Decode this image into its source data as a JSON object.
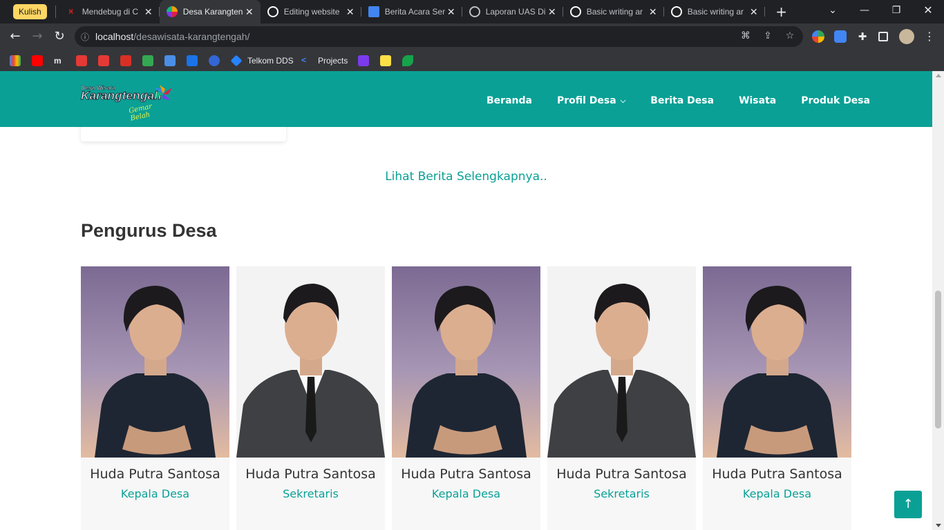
{
  "browser": {
    "tab_group": "Kulish",
    "tabs": [
      {
        "title": "Mendebug di C",
        "icon": "debug-icon",
        "color": "#c5221f"
      },
      {
        "title": "Desa Karangten",
        "icon": "site-favicon",
        "color": "#ffffff",
        "active": true
      },
      {
        "title": "Editing website",
        "icon": "github-icon",
        "color": "#ffffff"
      },
      {
        "title": "Berita Acara Ser",
        "icon": "docs-icon",
        "color": "#4285f4"
      },
      {
        "title": "Laporan UAS Di",
        "icon": "globe-icon",
        "color": "#bdc1c6"
      },
      {
        "title": "Basic writing ar",
        "icon": "github-icon",
        "color": "#ffffff"
      },
      {
        "title": "Basic writing ar",
        "icon": "github-icon",
        "color": "#ffffff"
      }
    ],
    "url_host": "localhost",
    "url_path": "/desawisata-karangtengah/",
    "bookmarks": [
      {
        "label": "Telkom DDS",
        "icon": "jira-icon"
      },
      {
        "label": "Projects",
        "icon": "projects-icon"
      }
    ]
  },
  "header": {
    "logo": {
      "line1": "Desa Wisata",
      "line2": "Karangtengah",
      "line3": "Gemar Belah"
    },
    "nav": [
      {
        "label": "Beranda"
      },
      {
        "label": "Profil Desa",
        "has_dropdown": true
      },
      {
        "label": "Berita Desa"
      },
      {
        "label": "Wisata"
      },
      {
        "label": "Produk Desa"
      }
    ]
  },
  "main": {
    "more_news_link": "Lihat Berita Selengkapnya..",
    "section_title": "Pengurus Desa",
    "officials": [
      {
        "name": "Huda Putra Santosa",
        "role": "Kepala Desa",
        "photo": "casual"
      },
      {
        "name": "Huda Putra Santosa",
        "role": "Sekretaris",
        "photo": "formal"
      },
      {
        "name": "Huda Putra Santosa",
        "role": "Kepala Desa",
        "photo": "casual"
      },
      {
        "name": "Huda Putra Santosa",
        "role": "Sekretaris",
        "photo": "formal"
      },
      {
        "name": "Huda Putra Santosa",
        "role": "Kepala Desa",
        "photo": "casual"
      }
    ]
  },
  "colors": {
    "brand": "#0aa096",
    "chrome_dark": "#202124",
    "chrome_toolbar": "#35363a"
  }
}
